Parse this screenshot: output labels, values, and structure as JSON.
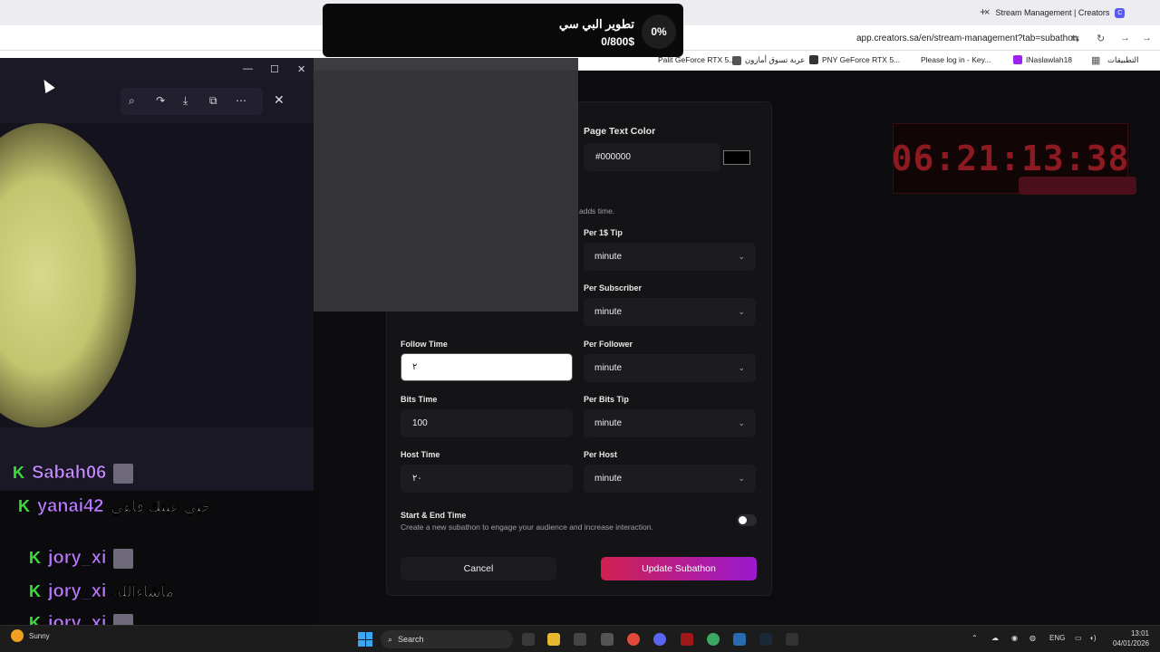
{
  "browser": {
    "tab_title": "Stream Management | Creators",
    "tab_favicon": "C",
    "new_tab": "+",
    "tab_close": "×",
    "url": "app.creators.sa/en/stream-management?tab=subathon",
    "bookmarks": [
      "التطبيقات",
      "INaslawlah18",
      "Please log in - Key...",
      "PNY GeForce RTX 5...",
      "عربة تسوق أمازون",
      "Palit GeForce RTX 5..."
    ]
  },
  "goal_overlay": {
    "title": "تطوير البي سي",
    "amount": "0/800$",
    "percent": "0%"
  },
  "timer": {
    "value": "06:21:13:38"
  },
  "modal": {
    "page_text_color_label": "Page Text Color",
    "page_text_color_value": "#000000",
    "page_text_color_swatch": "#000000",
    "adds_time_hint": "adds time.",
    "rows": [
      {
        "label": "Per 1$ Tip",
        "value": "minute"
      },
      {
        "label": "Per Subscriber",
        "value": "minute"
      },
      {
        "label": "Per Follower",
        "value": "minute"
      },
      {
        "label": "Per Bits Tip",
        "value": "minute"
      },
      {
        "label": "Per Host",
        "value": "minute"
      }
    ],
    "follow_time_label": "Follow Time",
    "follow_time_value": "٢",
    "bits_time_label": "Bits Time",
    "bits_time_value": "100",
    "host_time_label": "Host Time",
    "host_time_value": "٢٠",
    "start_end_label": "Start & End Time",
    "start_end_hint": "Create a new subathon to engage your audience and increase interaction.",
    "cancel_label": "Cancel",
    "update_label": "Update Subathon"
  },
  "chat": [
    {
      "user": "Sabah06",
      "message": ""
    },
    {
      "user": "yanai42",
      "message": "حيي عينك فاهي"
    },
    {
      "user": "jory_xi",
      "message": ""
    },
    {
      "user": "jory_xi",
      "message": "ماشاءالله"
    },
    {
      "user": "jory_xi",
      "message": ""
    }
  ],
  "kick_badge": "K",
  "taskbar": {
    "weather": "Sunny",
    "search_placeholder": "Search",
    "lang": "ENG",
    "time": "13:01",
    "date": "04/01/2026"
  },
  "colors": {
    "accent_gradient_start": "#d02050",
    "accent_gradient_end": "#9a1ad0",
    "timer_red": "#8d1a20",
    "kick_green": "#3ddc3d",
    "chat_username": "#b978ff"
  }
}
